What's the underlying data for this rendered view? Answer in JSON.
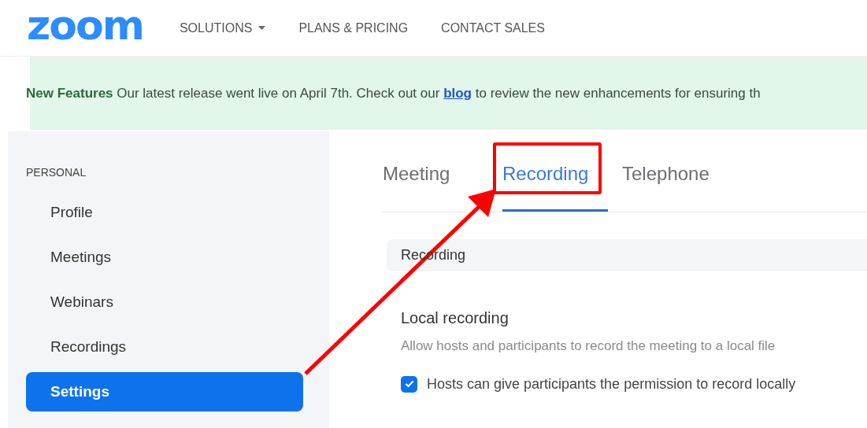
{
  "header": {
    "logo": "zoom",
    "nav": [
      {
        "label": "SOLUTIONS",
        "dropdown": true
      },
      {
        "label": "PLANS & PRICING",
        "dropdown": false
      },
      {
        "label": "CONTACT SALES",
        "dropdown": false
      }
    ]
  },
  "banner": {
    "lead": "New Features",
    "before": "Our latest release went live on April 7th. Check out our",
    "link": "blog",
    "after": "to review the new enhancements for ensuring th"
  },
  "sidebar": {
    "section": "PERSONAL",
    "items": [
      {
        "label": "Profile",
        "selected": false
      },
      {
        "label": "Meetings",
        "selected": false
      },
      {
        "label": "Webinars",
        "selected": false
      },
      {
        "label": "Recordings",
        "selected": false
      },
      {
        "label": "Settings",
        "selected": true
      }
    ]
  },
  "tabs": [
    {
      "label": "Meeting",
      "selected": false,
      "highlighted": false
    },
    {
      "label": "Recording",
      "selected": true,
      "highlighted": true
    },
    {
      "label": "Telephone",
      "selected": false,
      "highlighted": false
    }
  ],
  "section": {
    "title": "Recording"
  },
  "setting": {
    "title": "Local recording",
    "description": "Allow hosts and participants to record the meeting to a local file",
    "option": {
      "label": "Hosts can give participants the permission to record locally",
      "checked": true
    }
  }
}
